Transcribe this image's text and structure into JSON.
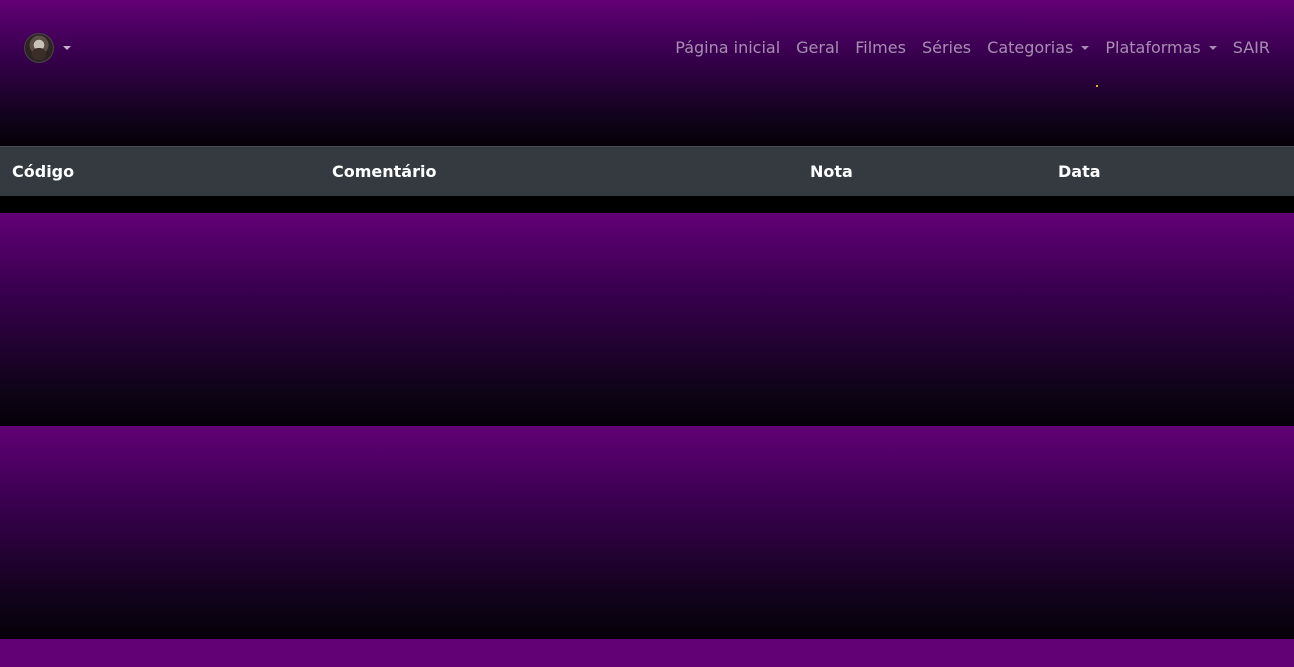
{
  "navbar": {
    "avatar_alt": "avatar",
    "links": {
      "home": "Página inicial",
      "general": "Geral",
      "movies": "Filmes",
      "series": "Séries",
      "categories": "Categorias",
      "platforms": "Plataformas",
      "logout": "SAIR"
    }
  },
  "table": {
    "columns": [
      "Código",
      "Comentário",
      "Nota",
      "Data"
    ],
    "rows": []
  },
  "colors": {
    "brand_purple": "#620076",
    "table_header": "#343a40"
  }
}
